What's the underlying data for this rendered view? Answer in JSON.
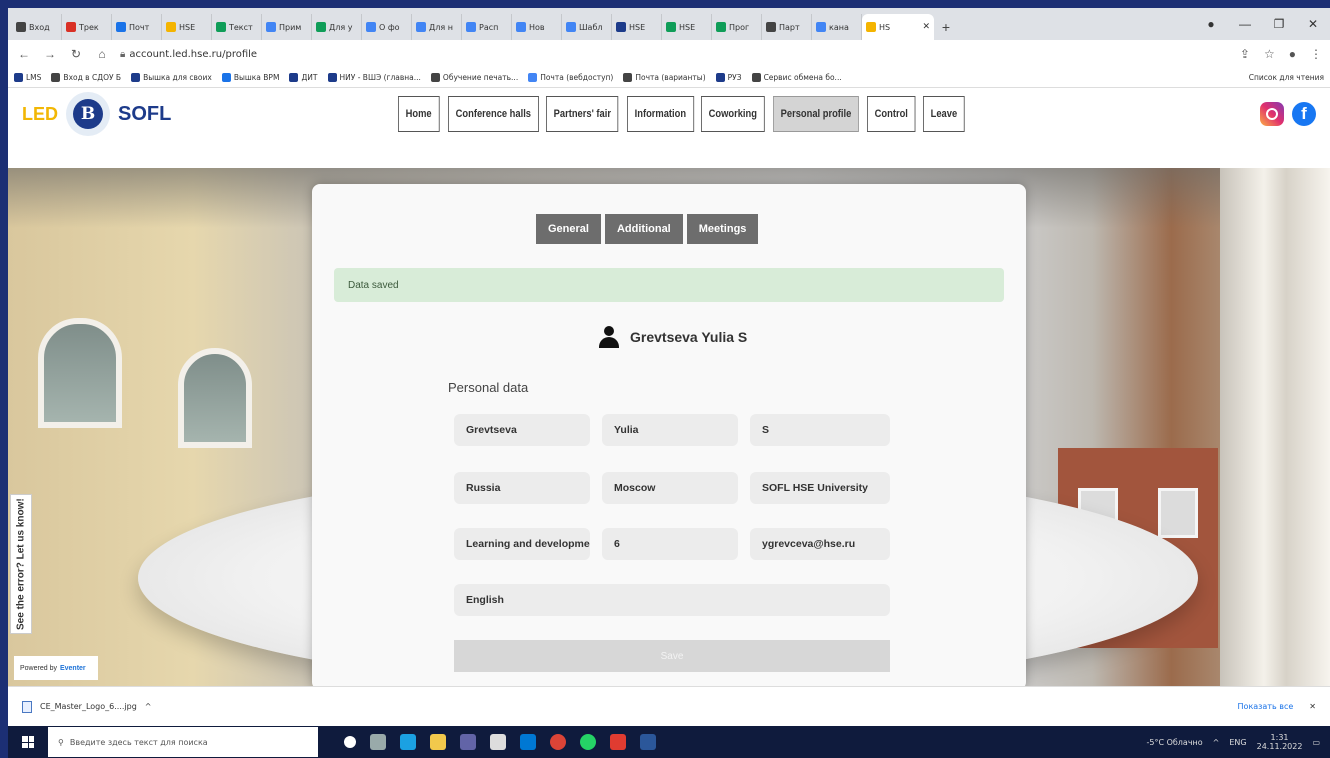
{
  "browser": {
    "tabs": [
      {
        "label": "Вход",
        "color": "#444444"
      },
      {
        "label": "Трек",
        "color": "#d93025"
      },
      {
        "label": "Почт",
        "color": "#1a73e8"
      },
      {
        "label": "HSE",
        "color": "#f4b400"
      },
      {
        "label": "Текст",
        "color": "#0f9d58"
      },
      {
        "label": "Прим",
        "color": "#4285f4"
      },
      {
        "label": "Для у",
        "color": "#0f9d58"
      },
      {
        "label": "О фо",
        "color": "#4285f4"
      },
      {
        "label": "Для н",
        "color": "#4285f4"
      },
      {
        "label": "Расп",
        "color": "#4285f4"
      },
      {
        "label": "Нов",
        "color": "#4285f4"
      },
      {
        "label": "Шабл",
        "color": "#4285f4"
      },
      {
        "label": "HSE",
        "color": "#1d3b8a"
      },
      {
        "label": "HSE",
        "color": "#0f9d58"
      },
      {
        "label": "Прог",
        "color": "#0f9d58"
      },
      {
        "label": "Парт",
        "color": "#444444"
      },
      {
        "label": "кана",
        "color": "#4285f4"
      }
    ],
    "active_tab": "HS",
    "url": "account.led.hse.ru/profile",
    "bookmarks": [
      "LMS",
      "Вход в СДОУ Б",
      "Вышка для своих",
      "Вышка ВРМ",
      "ДИТ",
      "НИУ - ВШЭ (главна...",
      "Обучение печать...",
      "Почта (вебдоступ)",
      "Почта (варианты)",
      "РУЗ",
      "Сервис обмена бо..."
    ],
    "bookmarks_right": "Список для чтения"
  },
  "site": {
    "logo_led": "LED",
    "logo_hse": "B",
    "logo_sofl": "SOFL",
    "nav": [
      "Home",
      "Conference halls",
      "Partners' fair",
      "Information",
      "Coworking",
      "Personal profile",
      "Control",
      "Leave"
    ],
    "active_nav": "Personal profile"
  },
  "profile": {
    "tabs": [
      "General",
      "Additional",
      "Meetings"
    ],
    "alert": "Data saved",
    "user_name": "Grevtseva Yulia S",
    "section_title": "Personal data",
    "fields": {
      "last_name": "Grevtseva",
      "first_name": "Yulia",
      "middle": "S",
      "country": "Russia",
      "city": "Moscow",
      "organization": "SOFL HSE University",
      "department": "Learning and developme",
      "number": "6",
      "email": "ygrevceva@hse.ru",
      "language": "English"
    },
    "save_label": "Save"
  },
  "widgets": {
    "feedback": "See the error? Let us know!",
    "powered_by": "Powered by",
    "powered_brand": "Eventer"
  },
  "downloads": {
    "file": "CE_Master_Logo_6....jpg",
    "show_all": "Показать все"
  },
  "taskbar": {
    "search_placeholder": "Введите здесь текст для поиска",
    "weather": "-5°C Облачно",
    "lang": "ENG",
    "time": "1:31",
    "date": "24.11.2022"
  }
}
